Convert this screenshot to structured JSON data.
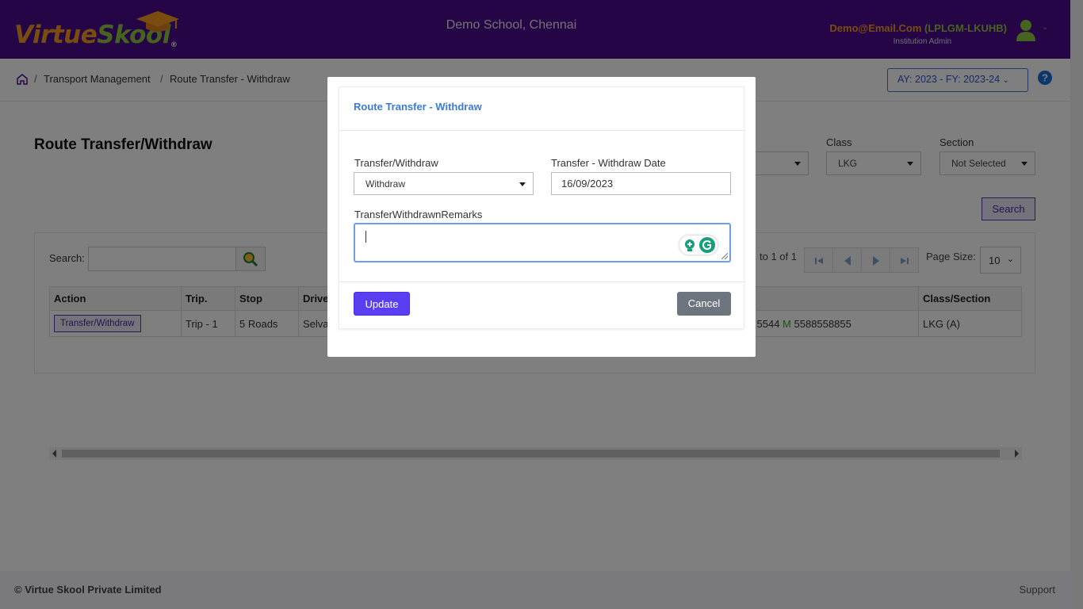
{
  "header": {
    "logo_part1": "Virtue",
    "logo_part2": "Skool",
    "logo_reg": "®",
    "school_name": "Demo School, Chennai",
    "user_email": "Demo@Email.Com",
    "user_code": "(LPLGM-LKUHB)",
    "user_role": "Institution Admin"
  },
  "breadcrumb": {
    "items": [
      "Transport Management",
      "Route Transfer - Withdraw"
    ],
    "separator": "/"
  },
  "academic_year": "AY: 2023 - FY: 2023-24",
  "page": {
    "title": "Route Transfer/Withdraw",
    "filters": {
      "class_label": "Class",
      "class_value": "LKG",
      "section_label": "Section",
      "section_value": "Not Selected"
    },
    "search_button": "Search"
  },
  "grid": {
    "search_label": "Search:",
    "pager_text": "to 1 of 1",
    "page_size_label": "Page Size:",
    "page_size": "10",
    "columns": [
      "Action",
      "Trip.",
      "Stop",
      "Drive",
      "Class/Section"
    ],
    "rows": [
      {
        "action": "Transfer/Withdraw",
        "trip": "Trip - 1",
        "stop": "5 Roads",
        "driver": "Selva",
        "mobile_prefix": "5544",
        "mobile_label": "M",
        "mobile_number": "5588558855",
        "class_section": "LKG (A)"
      }
    ]
  },
  "modal": {
    "title": "Route Transfer - Withdraw",
    "transfer_label": "Transfer/Withdraw",
    "transfer_value": "Withdraw",
    "date_label": "Transfer - Withdraw Date",
    "date_value": "16/09/2023",
    "remarks_label": "TransferWithdrawnRemarks",
    "remarks_value": "",
    "update_button": "Update",
    "cancel_button": "Cancel"
  },
  "footer": {
    "copyright": "© Virtue Skool Private Limited",
    "support": "Support"
  },
  "colors": {
    "header_bg": "#4a0a8c",
    "brand_orange": "#f39a1e",
    "brand_green": "#8cc63f",
    "primary_button": "#5a3ff2",
    "link_blue": "#3a7bd5"
  }
}
